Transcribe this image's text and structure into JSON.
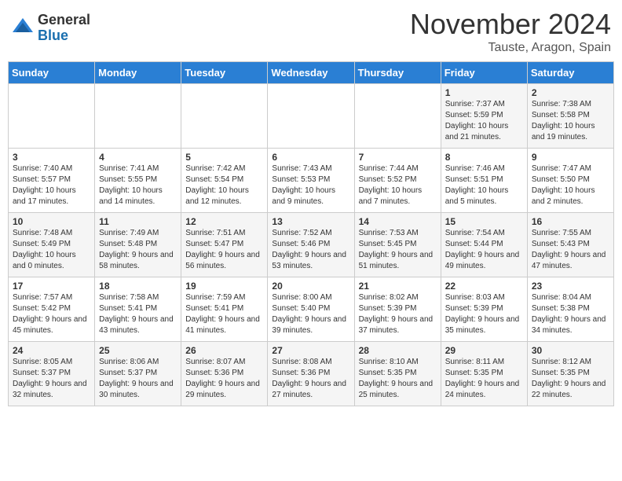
{
  "logo": {
    "general": "General",
    "blue": "Blue"
  },
  "title": "November 2024",
  "location": "Tauste, Aragon, Spain",
  "days_header": [
    "Sunday",
    "Monday",
    "Tuesday",
    "Wednesday",
    "Thursday",
    "Friday",
    "Saturday"
  ],
  "weeks": [
    [
      {
        "day": "",
        "sunrise": "",
        "sunset": "",
        "daylight": ""
      },
      {
        "day": "",
        "sunrise": "",
        "sunset": "",
        "daylight": ""
      },
      {
        "day": "",
        "sunrise": "",
        "sunset": "",
        "daylight": ""
      },
      {
        "day": "",
        "sunrise": "",
        "sunset": "",
        "daylight": ""
      },
      {
        "day": "",
        "sunrise": "",
        "sunset": "",
        "daylight": ""
      },
      {
        "day": "1",
        "sunrise": "Sunrise: 7:37 AM",
        "sunset": "Sunset: 5:59 PM",
        "daylight": "Daylight: 10 hours and 21 minutes."
      },
      {
        "day": "2",
        "sunrise": "Sunrise: 7:38 AM",
        "sunset": "Sunset: 5:58 PM",
        "daylight": "Daylight: 10 hours and 19 minutes."
      }
    ],
    [
      {
        "day": "3",
        "sunrise": "Sunrise: 7:40 AM",
        "sunset": "Sunset: 5:57 PM",
        "daylight": "Daylight: 10 hours and 17 minutes."
      },
      {
        "day": "4",
        "sunrise": "Sunrise: 7:41 AM",
        "sunset": "Sunset: 5:55 PM",
        "daylight": "Daylight: 10 hours and 14 minutes."
      },
      {
        "day": "5",
        "sunrise": "Sunrise: 7:42 AM",
        "sunset": "Sunset: 5:54 PM",
        "daylight": "Daylight: 10 hours and 12 minutes."
      },
      {
        "day": "6",
        "sunrise": "Sunrise: 7:43 AM",
        "sunset": "Sunset: 5:53 PM",
        "daylight": "Daylight: 10 hours and 9 minutes."
      },
      {
        "day": "7",
        "sunrise": "Sunrise: 7:44 AM",
        "sunset": "Sunset: 5:52 PM",
        "daylight": "Daylight: 10 hours and 7 minutes."
      },
      {
        "day": "8",
        "sunrise": "Sunrise: 7:46 AM",
        "sunset": "Sunset: 5:51 PM",
        "daylight": "Daylight: 10 hours and 5 minutes."
      },
      {
        "day": "9",
        "sunrise": "Sunrise: 7:47 AM",
        "sunset": "Sunset: 5:50 PM",
        "daylight": "Daylight: 10 hours and 2 minutes."
      }
    ],
    [
      {
        "day": "10",
        "sunrise": "Sunrise: 7:48 AM",
        "sunset": "Sunset: 5:49 PM",
        "daylight": "Daylight: 10 hours and 0 minutes."
      },
      {
        "day": "11",
        "sunrise": "Sunrise: 7:49 AM",
        "sunset": "Sunset: 5:48 PM",
        "daylight": "Daylight: 9 hours and 58 minutes."
      },
      {
        "day": "12",
        "sunrise": "Sunrise: 7:51 AM",
        "sunset": "Sunset: 5:47 PM",
        "daylight": "Daylight: 9 hours and 56 minutes."
      },
      {
        "day": "13",
        "sunrise": "Sunrise: 7:52 AM",
        "sunset": "Sunset: 5:46 PM",
        "daylight": "Daylight: 9 hours and 53 minutes."
      },
      {
        "day": "14",
        "sunrise": "Sunrise: 7:53 AM",
        "sunset": "Sunset: 5:45 PM",
        "daylight": "Daylight: 9 hours and 51 minutes."
      },
      {
        "day": "15",
        "sunrise": "Sunrise: 7:54 AM",
        "sunset": "Sunset: 5:44 PM",
        "daylight": "Daylight: 9 hours and 49 minutes."
      },
      {
        "day": "16",
        "sunrise": "Sunrise: 7:55 AM",
        "sunset": "Sunset: 5:43 PM",
        "daylight": "Daylight: 9 hours and 47 minutes."
      }
    ],
    [
      {
        "day": "17",
        "sunrise": "Sunrise: 7:57 AM",
        "sunset": "Sunset: 5:42 PM",
        "daylight": "Daylight: 9 hours and 45 minutes."
      },
      {
        "day": "18",
        "sunrise": "Sunrise: 7:58 AM",
        "sunset": "Sunset: 5:41 PM",
        "daylight": "Daylight: 9 hours and 43 minutes."
      },
      {
        "day": "19",
        "sunrise": "Sunrise: 7:59 AM",
        "sunset": "Sunset: 5:41 PM",
        "daylight": "Daylight: 9 hours and 41 minutes."
      },
      {
        "day": "20",
        "sunrise": "Sunrise: 8:00 AM",
        "sunset": "Sunset: 5:40 PM",
        "daylight": "Daylight: 9 hours and 39 minutes."
      },
      {
        "day": "21",
        "sunrise": "Sunrise: 8:02 AM",
        "sunset": "Sunset: 5:39 PM",
        "daylight": "Daylight: 9 hours and 37 minutes."
      },
      {
        "day": "22",
        "sunrise": "Sunrise: 8:03 AM",
        "sunset": "Sunset: 5:39 PM",
        "daylight": "Daylight: 9 hours and 35 minutes."
      },
      {
        "day": "23",
        "sunrise": "Sunrise: 8:04 AM",
        "sunset": "Sunset: 5:38 PM",
        "daylight": "Daylight: 9 hours and 34 minutes."
      }
    ],
    [
      {
        "day": "24",
        "sunrise": "Sunrise: 8:05 AM",
        "sunset": "Sunset: 5:37 PM",
        "daylight": "Daylight: 9 hours and 32 minutes."
      },
      {
        "day": "25",
        "sunrise": "Sunrise: 8:06 AM",
        "sunset": "Sunset: 5:37 PM",
        "daylight": "Daylight: 9 hours and 30 minutes."
      },
      {
        "day": "26",
        "sunrise": "Sunrise: 8:07 AM",
        "sunset": "Sunset: 5:36 PM",
        "daylight": "Daylight: 9 hours and 29 minutes."
      },
      {
        "day": "27",
        "sunrise": "Sunrise: 8:08 AM",
        "sunset": "Sunset: 5:36 PM",
        "daylight": "Daylight: 9 hours and 27 minutes."
      },
      {
        "day": "28",
        "sunrise": "Sunrise: 8:10 AM",
        "sunset": "Sunset: 5:35 PM",
        "daylight": "Daylight: 9 hours and 25 minutes."
      },
      {
        "day": "29",
        "sunrise": "Sunrise: 8:11 AM",
        "sunset": "Sunset: 5:35 PM",
        "daylight": "Daylight: 9 hours and 24 minutes."
      },
      {
        "day": "30",
        "sunrise": "Sunrise: 8:12 AM",
        "sunset": "Sunset: 5:35 PM",
        "daylight": "Daylight: 9 hours and 22 minutes."
      }
    ]
  ]
}
